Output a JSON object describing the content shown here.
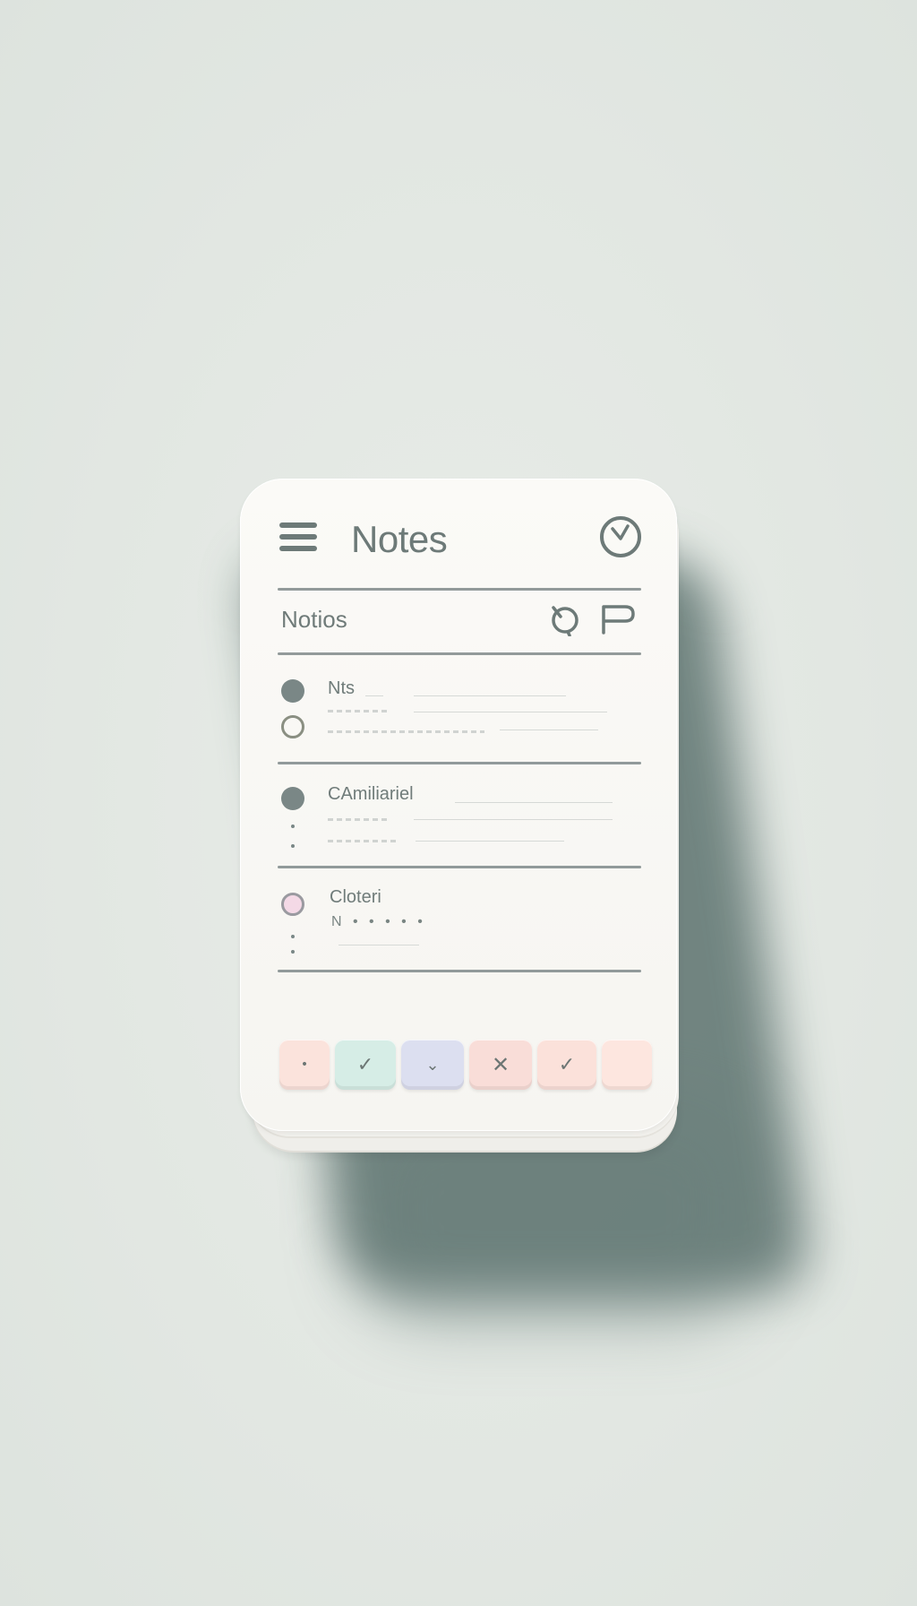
{
  "app": {
    "title": "Notes"
  },
  "toolbar": {
    "label": "Notios"
  },
  "list": {
    "items": [
      {
        "title": "Nts"
      },
      {
        "title": "CAmiliariel"
      },
      {
        "title": "Cloteri",
        "subtitle": "N • • • • •"
      }
    ]
  },
  "action_buttons": [
    {
      "glyph": "•",
      "color": "#fbe3dc"
    },
    {
      "glyph": "✓",
      "color": "#d6ede6"
    },
    {
      "glyph": "⌄",
      "color": "#dcdff0"
    },
    {
      "glyph": "✕",
      "color": "#f9ddd8"
    },
    {
      "glyph": "✓",
      "color": "#fbe1da"
    },
    {
      "glyph": "",
      "color": "#fde6df"
    }
  ],
  "icons": {
    "menu": "hamburger-menu-icon",
    "clock": "clock-icon",
    "tool_a": "rotate-icon",
    "tool_b": "pin-flag-icon"
  },
  "colors": {
    "background": "#e2e7e2",
    "card": "#f8f7f3",
    "text": "#6d7a78",
    "divider": "#7f8a89"
  }
}
